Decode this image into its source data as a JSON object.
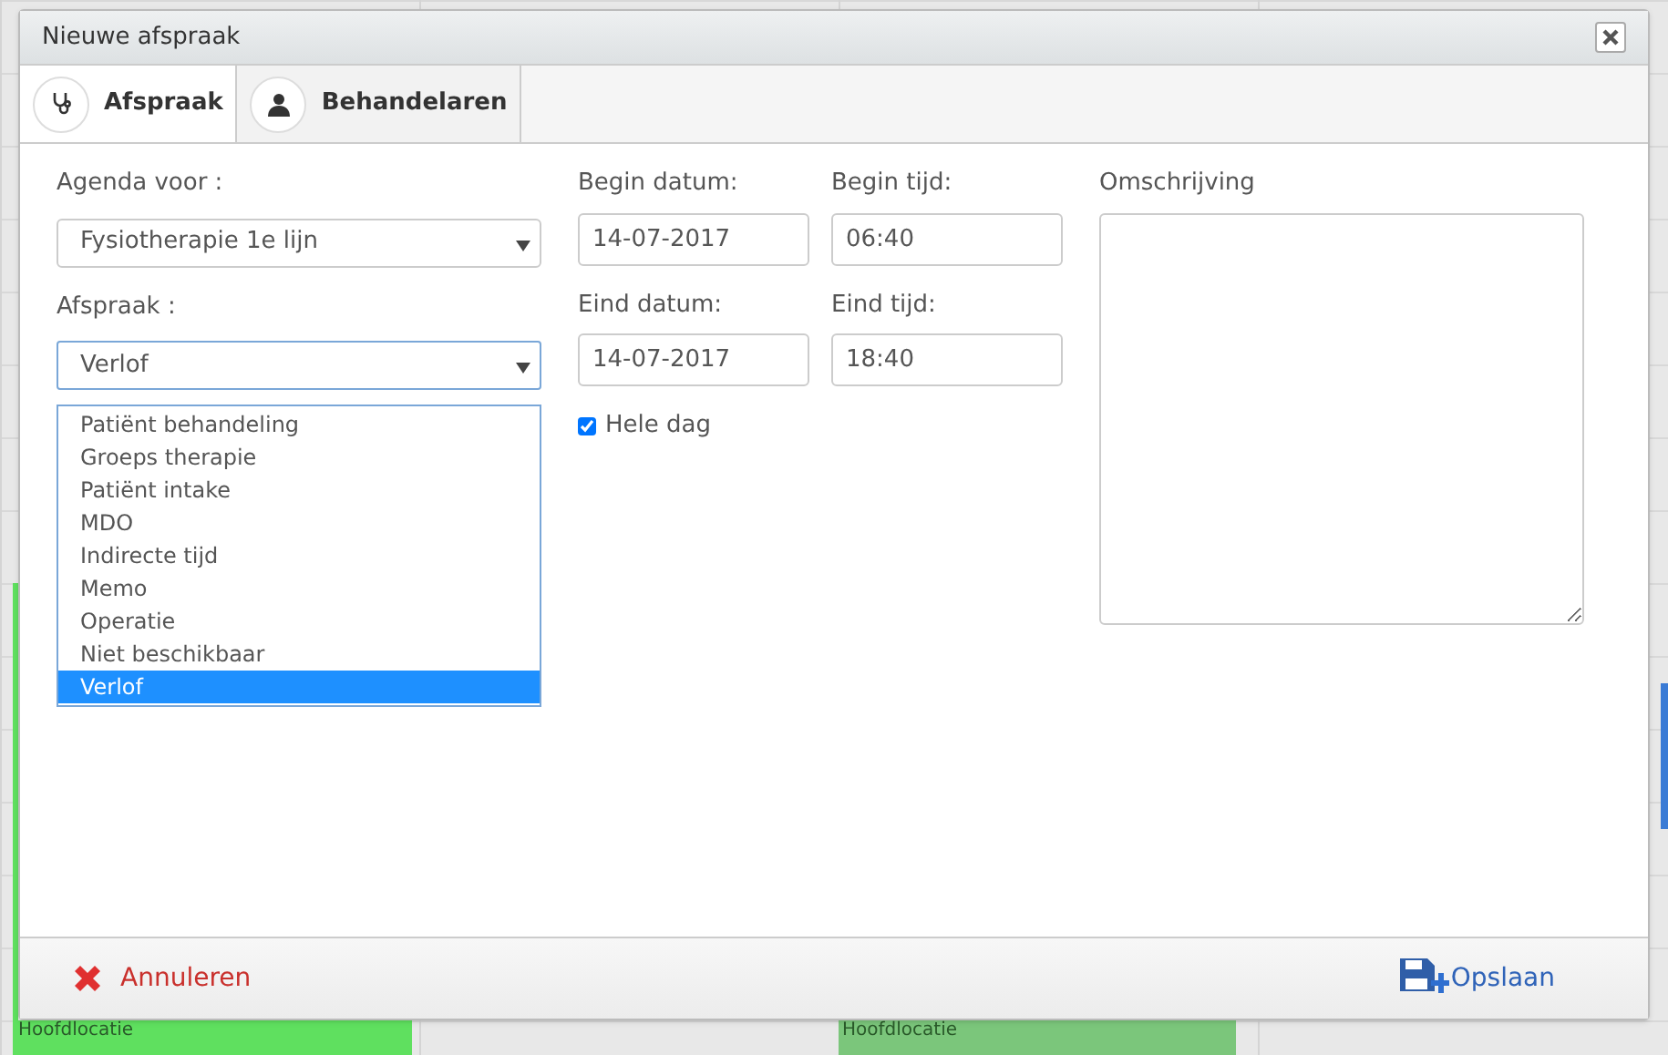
{
  "window": {
    "title": "Nieuwe afspraak"
  },
  "tabs": [
    {
      "label": "Afspraak",
      "kind": "stethoscope",
      "selected": true
    },
    {
      "label": "Behandelaren",
      "kind": "doctor",
      "selected": false
    }
  ],
  "form": {
    "agenda": {
      "label": "Agenda voor :",
      "value": "Fysiotherapie 1e lijn"
    },
    "afspraak": {
      "label": "Afspraak :",
      "value": "Verlof",
      "expanded": true,
      "options": [
        {
          "label": "Patiënt behandeling",
          "selected": false
        },
        {
          "label": "Groeps therapie",
          "selected": false
        },
        {
          "label": "Patiënt intake",
          "selected": false
        },
        {
          "label": "MDO",
          "selected": false
        },
        {
          "label": "Indirecte tijd",
          "selected": false
        },
        {
          "label": "Memo",
          "selected": false
        },
        {
          "label": "Operatie",
          "selected": false
        },
        {
          "label": "Niet beschikbaar",
          "selected": false
        },
        {
          "label": "Verlof",
          "selected": true
        }
      ]
    },
    "begin_datum": {
      "label": "Begin datum:",
      "value": "14-07-2017"
    },
    "begin_tijd": {
      "label": "Begin tijd:",
      "value": "06:40"
    },
    "eind_datum": {
      "label": "Eind datum:",
      "value": "14-07-2017"
    },
    "eind_tijd": {
      "label": "Eind tijd:",
      "value": "18:40"
    },
    "hele_dag": {
      "label": "Hele dag",
      "checked": true
    },
    "omschrijving": {
      "label": "Omschrijving"
    }
  },
  "footer": {
    "cancel": "Annuleren",
    "save": "Opslaan"
  },
  "calendar_events": [
    {
      "location": "Hoofdlocatie",
      "color": "#5fe05f"
    },
    {
      "location": "Hoofdlocatie",
      "color": "#7bc67b"
    }
  ]
}
